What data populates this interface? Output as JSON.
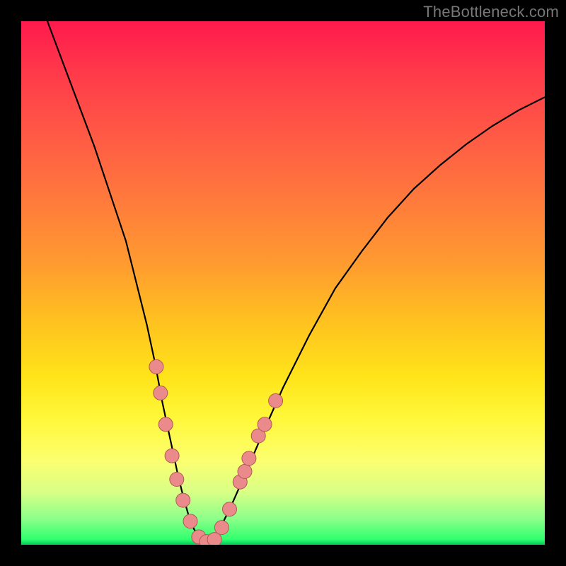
{
  "watermark": "TheBottleneck.com",
  "colors": {
    "background": "#000000",
    "curve": "#000000",
    "dot_fill": "#eb8a8a",
    "dot_stroke": "#b05858"
  },
  "chart_data": {
    "type": "line",
    "title": "",
    "xlabel": "",
    "ylabel": "",
    "xlim": [
      0,
      100
    ],
    "ylim": [
      0,
      100
    ],
    "series": [
      {
        "name": "curve",
        "x": [
          5,
          8,
          11,
          14,
          17,
          20,
          22,
          24,
          25.5,
          27,
          28.5,
          30,
          31,
          32,
          33,
          34,
          35,
          36,
          37,
          38,
          40,
          43,
          46,
          50,
          55,
          60,
          65,
          70,
          75,
          80,
          85,
          90,
          95,
          100
        ],
        "y": [
          100,
          92,
          84,
          76,
          67,
          58,
          50,
          42,
          35,
          27,
          20,
          13,
          9,
          5.5,
          3,
          1.3,
          0.5,
          0.5,
          1.5,
          3.2,
          7.2,
          14,
          21,
          30,
          40,
          49,
          56,
          62.5,
          68,
          72.5,
          76.5,
          80,
          83,
          85.5
        ]
      }
    ],
    "markers": {
      "name": "dots",
      "points": [
        {
          "x": 25.8,
          "y": 34
        },
        {
          "x": 26.6,
          "y": 29
        },
        {
          "x": 27.6,
          "y": 23
        },
        {
          "x": 28.8,
          "y": 17
        },
        {
          "x": 29.7,
          "y": 12.5
        },
        {
          "x": 30.9,
          "y": 8.5
        },
        {
          "x": 32.3,
          "y": 4.5
        },
        {
          "x": 33.9,
          "y": 1.5
        },
        {
          "x": 35.4,
          "y": 0.6
        },
        {
          "x": 36.9,
          "y": 1.0
        },
        {
          "x": 38.3,
          "y": 3.3
        },
        {
          "x": 39.8,
          "y": 6.8
        },
        {
          "x": 41.8,
          "y": 12
        },
        {
          "x": 42.7,
          "y": 14
        },
        {
          "x": 43.5,
          "y": 16.5
        },
        {
          "x": 45.3,
          "y": 20.8
        },
        {
          "x": 46.5,
          "y": 23
        },
        {
          "x": 48.6,
          "y": 27.5
        }
      ],
      "radius": 10
    }
  }
}
